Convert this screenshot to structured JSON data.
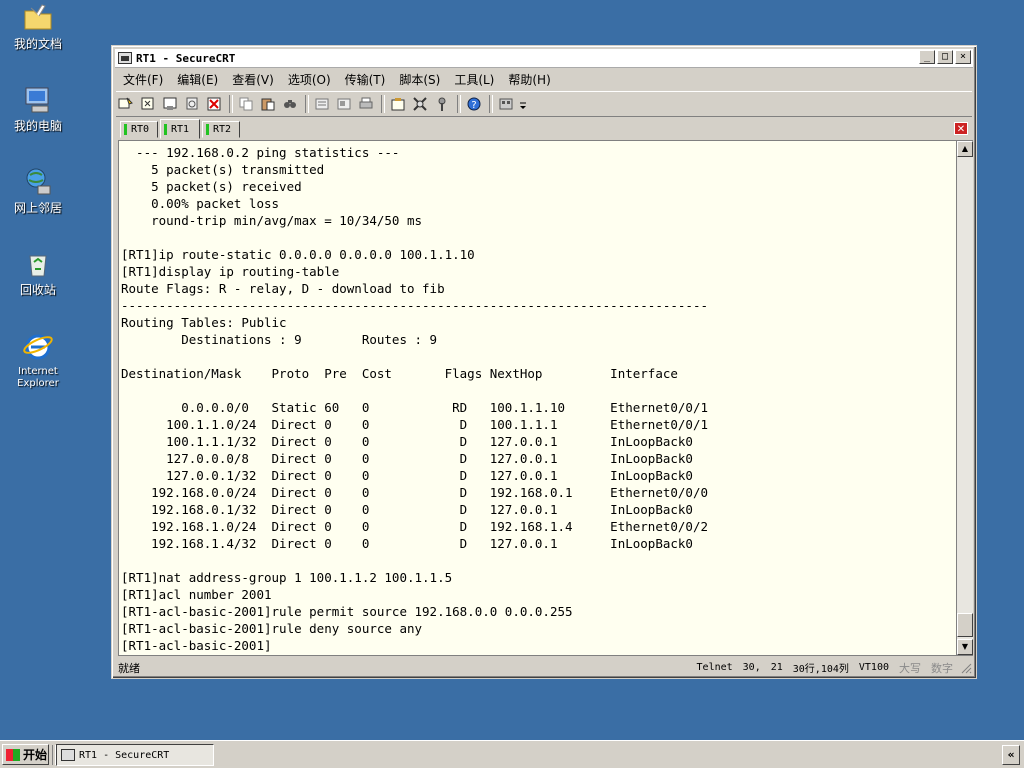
{
  "desktop": {
    "icons": [
      {
        "label": "我的文档",
        "icon": "folder-icon"
      },
      {
        "label": "我的电脑",
        "icon": "computer-icon"
      },
      {
        "label": "网上邻居",
        "icon": "network-icon"
      },
      {
        "label": "回收站",
        "icon": "recycle-bin-icon"
      },
      {
        "label": "Internet Explorer",
        "icon": "internet-explorer-icon"
      }
    ]
  },
  "window": {
    "title": "RT1 - SecureCRT",
    "controls": {
      "minimize": "_",
      "maximize": "□",
      "close": "×"
    }
  },
  "menu": [
    "文件(F)",
    "编辑(E)",
    "查看(V)",
    "选项(O)",
    "传输(T)",
    "脚本(S)",
    "工具(L)",
    "帮助(H)"
  ],
  "tabs": [
    {
      "label": "RT0",
      "active": false
    },
    {
      "label": "RT1",
      "active": true
    },
    {
      "label": "RT2",
      "active": false
    }
  ],
  "terminal": {
    "lines": [
      "  --- 192.168.0.2 ping statistics ---",
      "    5 packet(s) transmitted",
      "    5 packet(s) received",
      "    0.00% packet loss",
      "    round-trip min/avg/max = 10/34/50 ms",
      "",
      "[RT1]ip route-static 0.0.0.0 0.0.0.0 100.1.1.10",
      "[RT1]display ip routing-table",
      "Route Flags: R - relay, D - download to fib",
      "------------------------------------------------------------------------------",
      "Routing Tables: Public",
      "        Destinations : 9        Routes : 9",
      "",
      "Destination/Mask    Proto  Pre  Cost       Flags NextHop         Interface",
      "",
      "        0.0.0.0/0   Static 60   0           RD   100.1.1.10      Ethernet0/0/1",
      "      100.1.1.0/24  Direct 0    0            D   100.1.1.1       Ethernet0/0/1",
      "      100.1.1.1/32  Direct 0    0            D   127.0.0.1       InLoopBack0",
      "      127.0.0.0/8   Direct 0    0            D   127.0.0.1       InLoopBack0",
      "      127.0.0.1/32  Direct 0    0            D   127.0.0.1       InLoopBack0",
      "    192.168.0.0/24  Direct 0    0            D   192.168.0.1     Ethernet0/0/0",
      "    192.168.0.1/32  Direct 0    0            D   127.0.0.1       InLoopBack0",
      "    192.168.1.0/24  Direct 0    0            D   192.168.1.4     Ethernet0/0/2",
      "    192.168.1.4/32  Direct 0    0            D   127.0.0.1       InLoopBack0",
      "",
      "[RT1]nat address-group 1 100.1.1.2 100.1.1.5",
      "[RT1]acl number 2001",
      "[RT1-acl-basic-2001]rule permit source 192.168.0.0 0.0.0.255",
      "[RT1-acl-basic-2001]rule deny source any",
      "[RT1-acl-basic-2001]"
    ]
  },
  "status": {
    "ready": "就绪",
    "protocol": "Telnet",
    "row": "30,",
    "col": "21",
    "size": "30行,104列",
    "emulation": "VT100",
    "caps": "大写",
    "num": "数字"
  },
  "taskbar": {
    "start_label": "开始",
    "task_label": "RT1 - SecureCRT",
    "tray_arrow": "«"
  }
}
